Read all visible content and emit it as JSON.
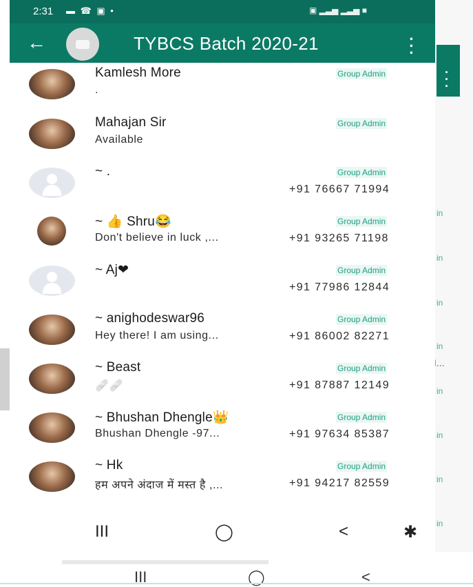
{
  "status_bar": {
    "time": "2:31"
  },
  "header": {
    "title": "TYBCS Batch 2020-21",
    "back_icon": "←",
    "menu_icon": "⋮"
  },
  "members": [
    {
      "name": "Kamlesh More",
      "about": ".",
      "phone": "",
      "badge": "Group Admin",
      "avatar": "photo"
    },
    {
      "name": "Mahajan Sir",
      "about": "Available",
      "phone": "",
      "badge": "Group Admin",
      "avatar": "photo"
    },
    {
      "name": "~ .",
      "about": "",
      "phone": "+91 76667 71994",
      "badge": "Group Admin",
      "avatar": "placeholder"
    },
    {
      "name": "~ 👍 Shru😂",
      "about": "Don't believe in luck ,...",
      "phone": "+91 93265 71198",
      "badge": "Group Admin",
      "avatar": "photo"
    },
    {
      "name": "~ Aj❤",
      "about": "",
      "phone": "+91 77986 12844",
      "badge": "Group Admin",
      "avatar": "placeholder"
    },
    {
      "name": "~ anighodeswar96",
      "about": "Hey there! I am using...",
      "phone": "+91 86002 82271",
      "badge": "Group Admin",
      "avatar": "photo"
    },
    {
      "name": "~ Beast",
      "about": "🩹🩹",
      "phone": "+91 87887 12149",
      "badge": "Group Admin",
      "avatar": "photo"
    },
    {
      "name": "~ Bhushan Dhengle👑",
      "about": "Bhushan Dhengle -97...",
      "phone": "+91 97634 85387",
      "badge": "Group Admin",
      "avatar": "photo"
    },
    {
      "name": "~ Hk",
      "about": "हम अपने अंदाज में मस्त है ,...",
      "phone": "+91 94217 82559",
      "badge": "Group Admin",
      "avatar": "photo"
    }
  ],
  "nav": {
    "recents": "III",
    "home": "◯",
    "back": "<",
    "accessibility": "✱"
  },
  "background": {
    "in_label": "in",
    "ellipsis": "I..."
  },
  "colors": {
    "header": "#0b7a65",
    "status_bar": "#0b6e5c",
    "accent": "#1f9e86"
  }
}
